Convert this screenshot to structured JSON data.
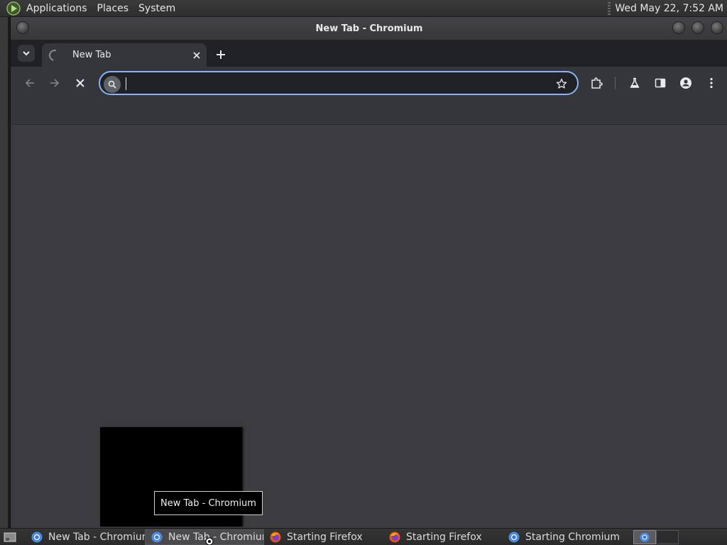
{
  "top_panel": {
    "menus": [
      "Applications",
      "Places",
      "System"
    ],
    "clock": "Wed May 22,  7:52 AM"
  },
  "window": {
    "title": "New Tab - Chromium"
  },
  "browser": {
    "tab": {
      "title": "New Tab",
      "state": "loading"
    },
    "omnibox": {
      "value": "",
      "placeholder": ""
    },
    "icons": {
      "tab_search": "chevron-down-icon",
      "tab_close": "close-icon",
      "new_tab": "plus-icon",
      "back": "arrow-left-icon",
      "forward": "arrow-right-icon",
      "stop": "close-icon",
      "search": "search-icon",
      "bookmark": "star-icon",
      "extensions": "puzzle-icon",
      "labs": "flask-icon",
      "side_panel": "side-panel-icon",
      "profile": "person-icon",
      "menu": "kebab-menu-icon"
    }
  },
  "tooltip": {
    "text": "New Tab - Chromium"
  },
  "taskbar": {
    "tasks": [
      {
        "label": "New Tab - Chromium",
        "app": "chromium",
        "active": false
      },
      {
        "label": "New Tab - Chromium",
        "app": "chromium",
        "active": true
      },
      {
        "label": "Starting Firefox",
        "app": "firefox",
        "active": false
      },
      {
        "label": "Starting Firefox",
        "app": "firefox",
        "active": false
      },
      {
        "label": "Starting Chromium",
        "app": "chromium",
        "active": false
      }
    ]
  },
  "colors": {
    "accent": "#8ab4f8",
    "toolbar": "#35363a",
    "tabstrip": "#202124",
    "content": "#3b3b40"
  }
}
